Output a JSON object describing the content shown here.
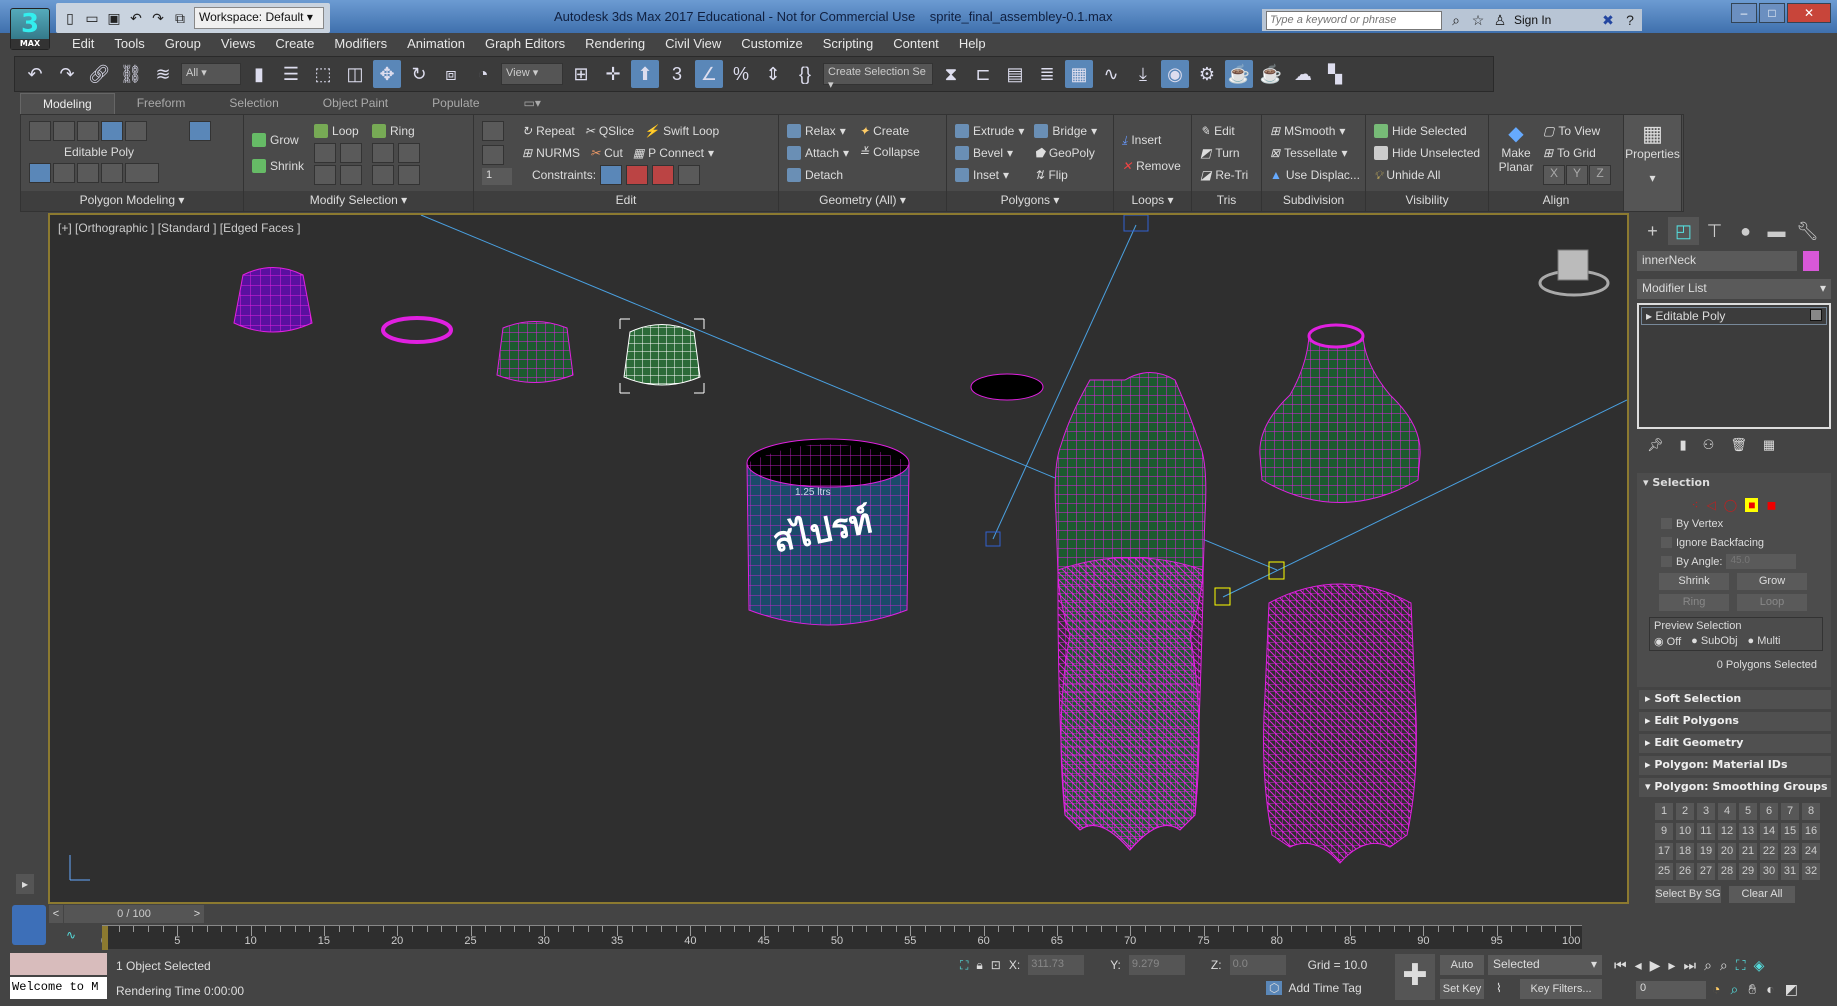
{
  "app": {
    "logo": "3",
    "logo_sub": "MAX",
    "title": "Autodesk 3ds Max 2017 Educational - Not for Commercial Use    sprite_final_assembley-0.1.max",
    "workspace": "Workspace: Default",
    "search_placeholder": "Type a keyword or phrase",
    "sign_in": "Sign In"
  },
  "menu": [
    "Edit",
    "Tools",
    "Group",
    "Views",
    "Create",
    "Modifiers",
    "Animation",
    "Graph Editors",
    "Rendering",
    "Civil View",
    "Customize",
    "Scripting",
    "Content",
    "Help"
  ],
  "toolbar": {
    "filter": "All",
    "coord": "View",
    "named_selection": "Create Selection Se"
  },
  "ribbon_tabs": [
    "Modeling",
    "Freeform",
    "Selection",
    "Object Paint",
    "Populate"
  ],
  "ribbon": {
    "polygon_modeling": {
      "label": "Polygon Modeling",
      "object": "Editable Poly"
    },
    "modify_selection": {
      "label": "Modify Selection",
      "grow": "Grow",
      "shrink": "Shrink",
      "loop": "Loop",
      "ring": "Ring"
    },
    "edit": {
      "label": "Edit",
      "spinner": "1",
      "repeat": "Repeat",
      "qslice": "QSlice",
      "swift_loop": "Swift Loop",
      "nurms": "NURMS",
      "cut": "Cut",
      "p_connect": "P Connect",
      "constraints": "Constraints:"
    },
    "geometry": {
      "label": "Geometry (All)",
      "relax": "Relax",
      "create": "Create",
      "attach": "Attach",
      "collapse": "Collapse",
      "detach": "Detach"
    },
    "polygons": {
      "label": "Polygons",
      "extrude": "Extrude",
      "bridge": "Bridge",
      "bevel": "Bevel",
      "geopoly": "GeoPoly",
      "inset": "Inset",
      "flip": "Flip"
    },
    "loops": {
      "label": "Loops",
      "insert": "Insert",
      "remove": "Remove"
    },
    "tris": {
      "label": "Tris",
      "edit": "Edit",
      "turn": "Turn",
      "retri": "Re-Tri"
    },
    "subdivision": {
      "label": "Subdivision",
      "msmooth": "MSmooth",
      "tessellate": "Tessellate",
      "use_displace": "Use Displac..."
    },
    "visibility": {
      "label": "Visibility",
      "hide_selected": "Hide Selected",
      "hide_unselected": "Hide Unselected",
      "unhide_all": "Unhide All"
    },
    "align": {
      "label": "Align",
      "make_planar": "Make Planar",
      "to_view": "To View",
      "to_grid": "To Grid",
      "x": "X",
      "y": "Y",
      "z": "Z"
    },
    "properties": {
      "label": "Properties"
    }
  },
  "viewport": {
    "label": "[+] [Orthographic ] [Standard ] [Edged Faces ]",
    "wire_color": "#e020e0",
    "selected_color": "#ffffff",
    "border_color": "#8c7a30",
    "bottle_label": "1.25 ltrs"
  },
  "command_panel": {
    "object_name": "innerNeck",
    "object_color": "#d858d8",
    "modifier_list": "Modifier List",
    "stack": [
      "Editable Poly"
    ],
    "selection": {
      "title": "Selection",
      "by_vertex": "By Vertex",
      "ignore_backfacing": "Ignore Backfacing",
      "by_angle": "By Angle:",
      "angle": "45.0",
      "shrink": "Shrink",
      "grow": "Grow",
      "ring": "Ring",
      "loop": "Loop",
      "preview": "Preview Selection",
      "off": "Off",
      "subobj": "SubObj",
      "multi": "Multi",
      "preview_value": "Off",
      "status": "0 Polygons Selected"
    },
    "rollouts": [
      "Soft Selection",
      "Edit Polygons",
      "Edit Geometry",
      "Polygon: Material IDs"
    ],
    "smoothing": {
      "title": "Polygon: Smoothing Groups",
      "groups": [
        "1",
        "2",
        "3",
        "4",
        "5",
        "6",
        "7",
        "8",
        "9",
        "10",
        "11",
        "12",
        "13",
        "14",
        "15",
        "16",
        "17",
        "18",
        "19",
        "20",
        "21",
        "22",
        "23",
        "24",
        "25",
        "26",
        "27",
        "28",
        "29",
        "30",
        "31",
        "32"
      ],
      "select_by_sg": "Select By SG",
      "clear_all": "Clear All"
    }
  },
  "timeline": {
    "slider": "0 / 100",
    "ticks": [
      "0",
      "5",
      "10",
      "15",
      "20",
      "25",
      "30",
      "35",
      "40",
      "45",
      "50",
      "55",
      "60",
      "65",
      "70",
      "75",
      "80",
      "85",
      "90",
      "95",
      "100"
    ]
  },
  "status": {
    "maxscript": "Welcome to M",
    "selected": "1 Object Selected",
    "rendering": "Rendering Time  0:00:00",
    "x_label": "X:",
    "x": "311.73",
    "y_label": "Y:",
    "y": "9.279",
    "z_label": "Z:",
    "z": "0.0",
    "grid": "Grid = 10.0",
    "add_time_tag": "Add Time Tag",
    "auto_key": "Auto Key",
    "set_key": "Set Key",
    "key_mode": "Selected",
    "key_filters": "Key Filters...",
    "frame": "0"
  }
}
